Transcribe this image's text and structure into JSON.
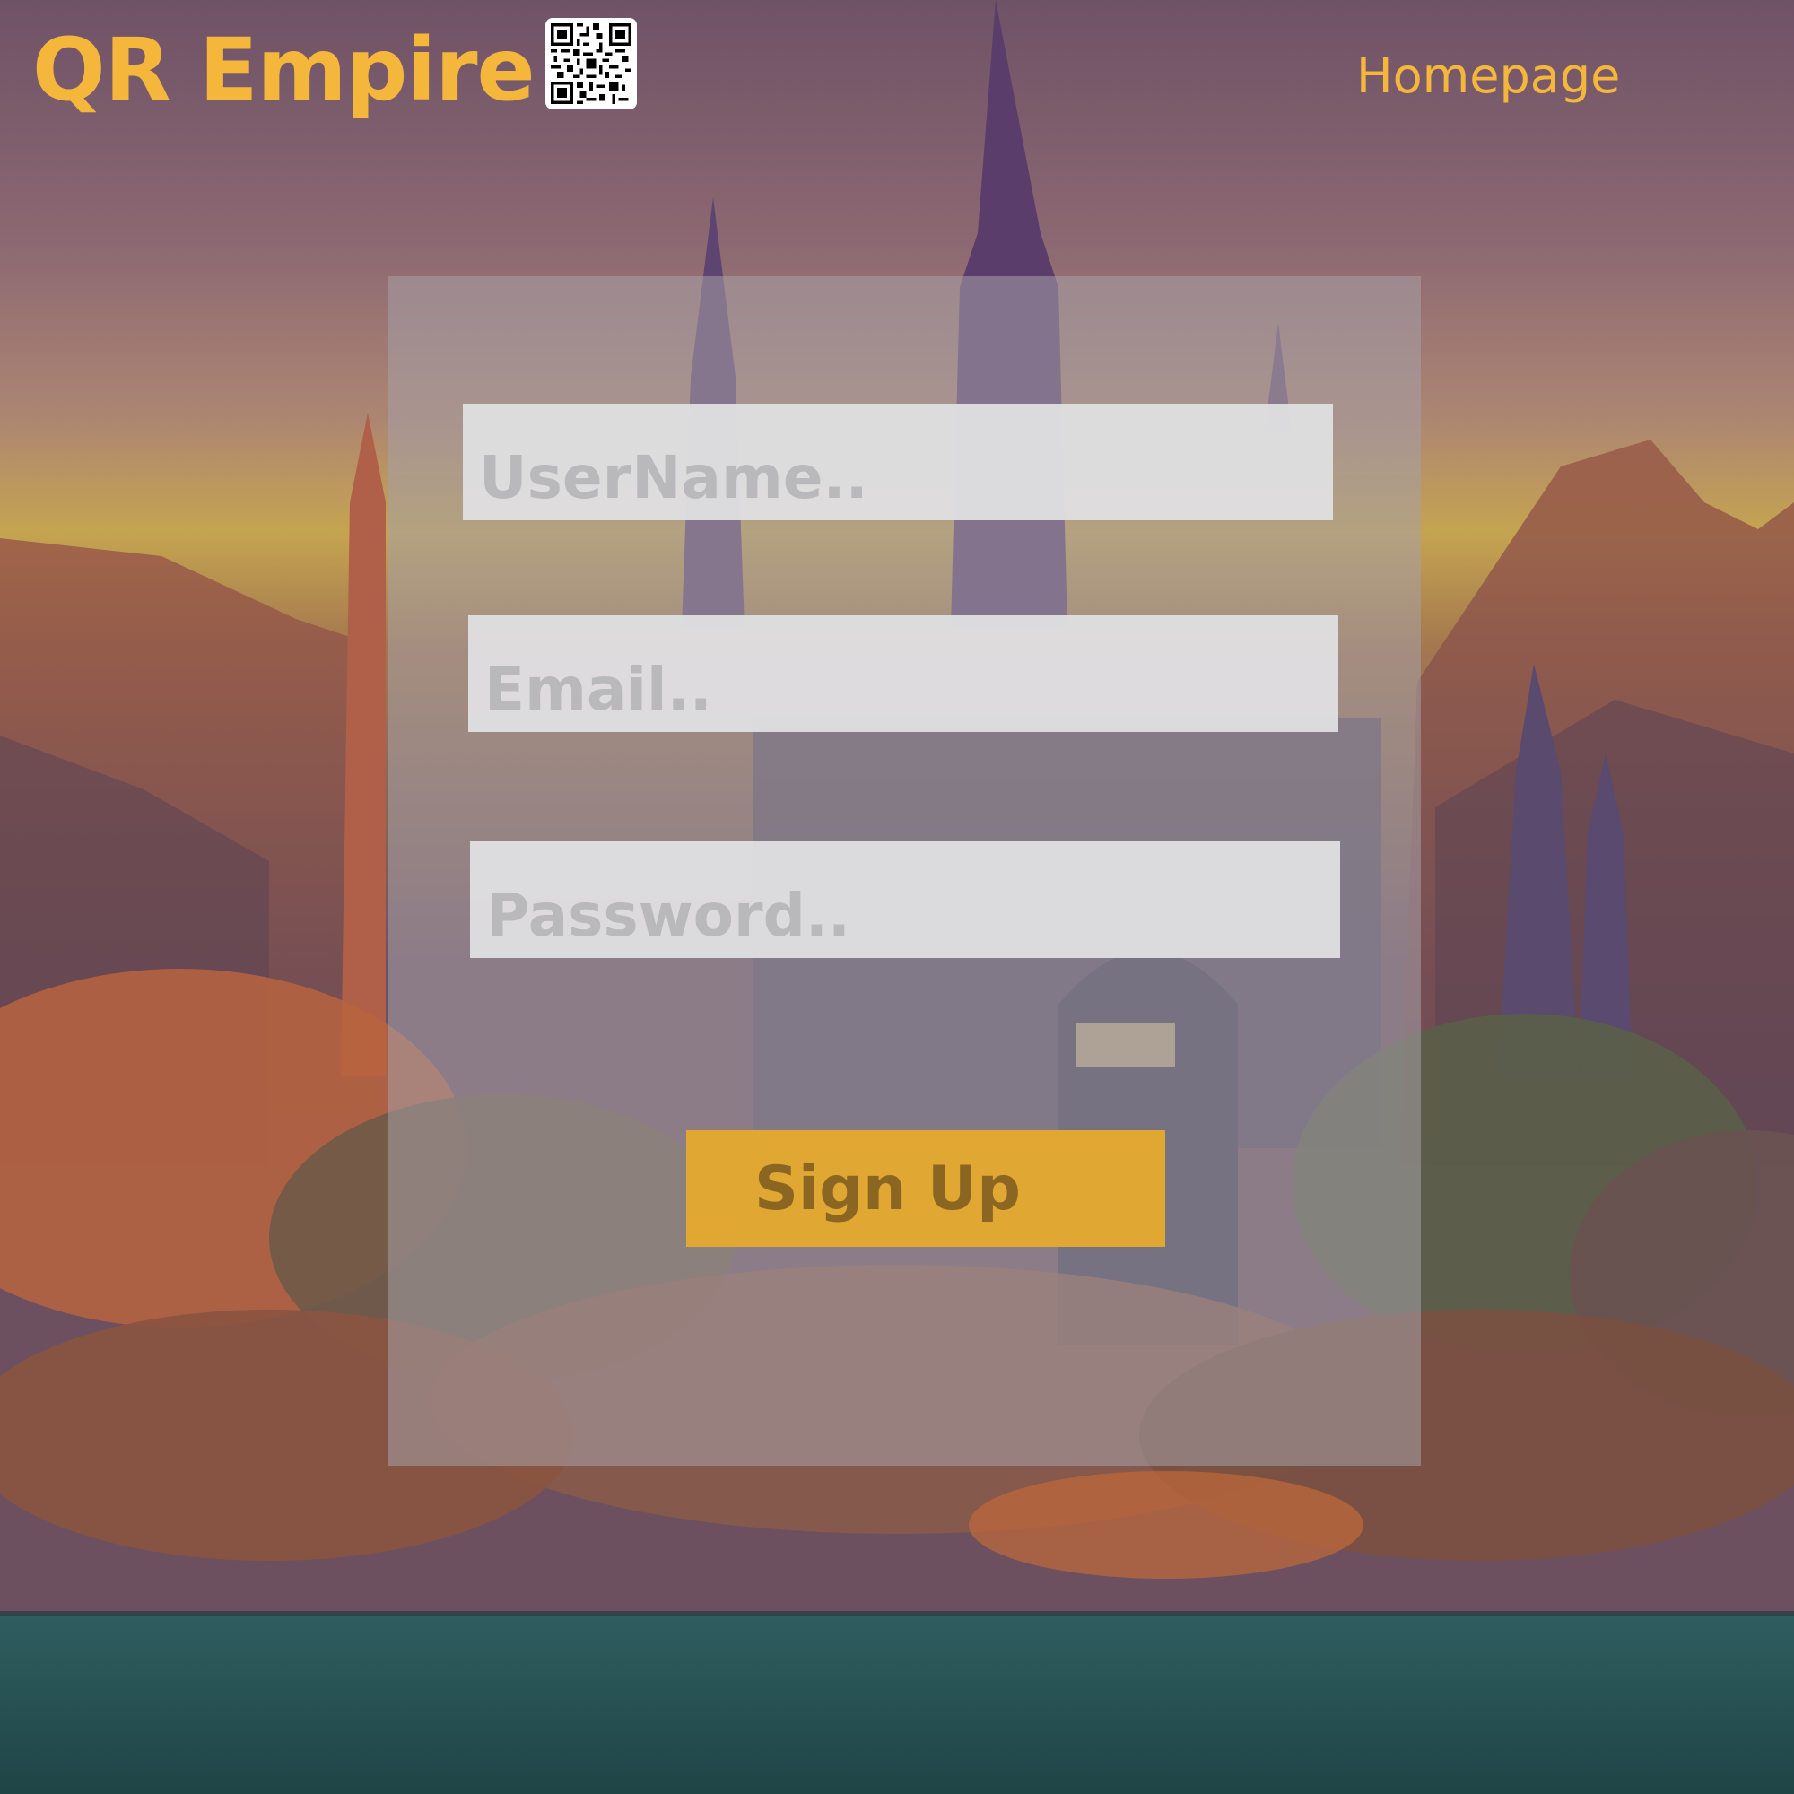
{
  "header": {
    "brand_name": "QR Empire",
    "brand_icon": "qr-code-icon",
    "nav_link": "Homepage"
  },
  "signup_form": {
    "username_placeholder": "UserName..",
    "email_placeholder": "Email..",
    "password_placeholder": "Password..",
    "submit_label": "Sign Up"
  },
  "colors": {
    "accent": "#f4b73c",
    "button_bg": "#e0a832",
    "button_text": "#8b6522",
    "field_bg": "#e0e0e2",
    "placeholder": "#b9b9bb",
    "panel": "#a5a0a8"
  },
  "background": {
    "icon": "castle-landscape-image"
  }
}
